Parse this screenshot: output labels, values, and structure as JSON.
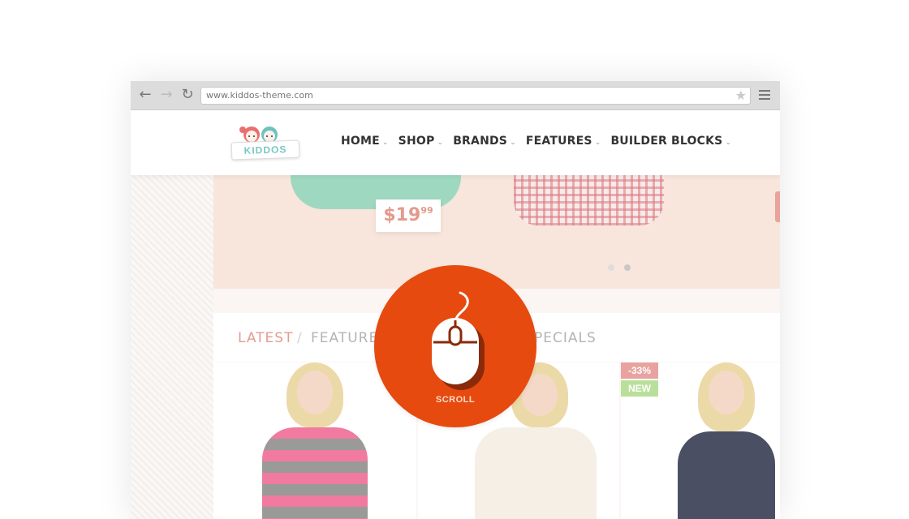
{
  "browser": {
    "url": "www.kiddos-theme.com"
  },
  "site": {
    "logo_text": "KIDDOS",
    "nav": [
      {
        "label": "HOME"
      },
      {
        "label": "SHOP"
      },
      {
        "label": "BRANDS"
      },
      {
        "label": "FEATURES"
      },
      {
        "label": "BUILDER BLOCKS"
      }
    ]
  },
  "hero": {
    "price_main": "$19",
    "price_cents": "99",
    "slides_count": 2,
    "active_slide": 2
  },
  "product_tabs": {
    "latest": "LATEST",
    "separator": "/",
    "featured": "FEATURE",
    "specials": "PECIALS"
  },
  "products": [
    {
      "badges": []
    },
    {
      "badges": []
    },
    {
      "badges": [
        {
          "text": "-33%"
        },
        {
          "text": "NEW"
        }
      ]
    }
  ],
  "scroll": {
    "label": "SCROLL"
  },
  "colors": {
    "accent": "#e64a0f",
    "hero_bg": "#f8e6dc",
    "tab_active": "#e49c92",
    "price": "#e39a8d"
  }
}
